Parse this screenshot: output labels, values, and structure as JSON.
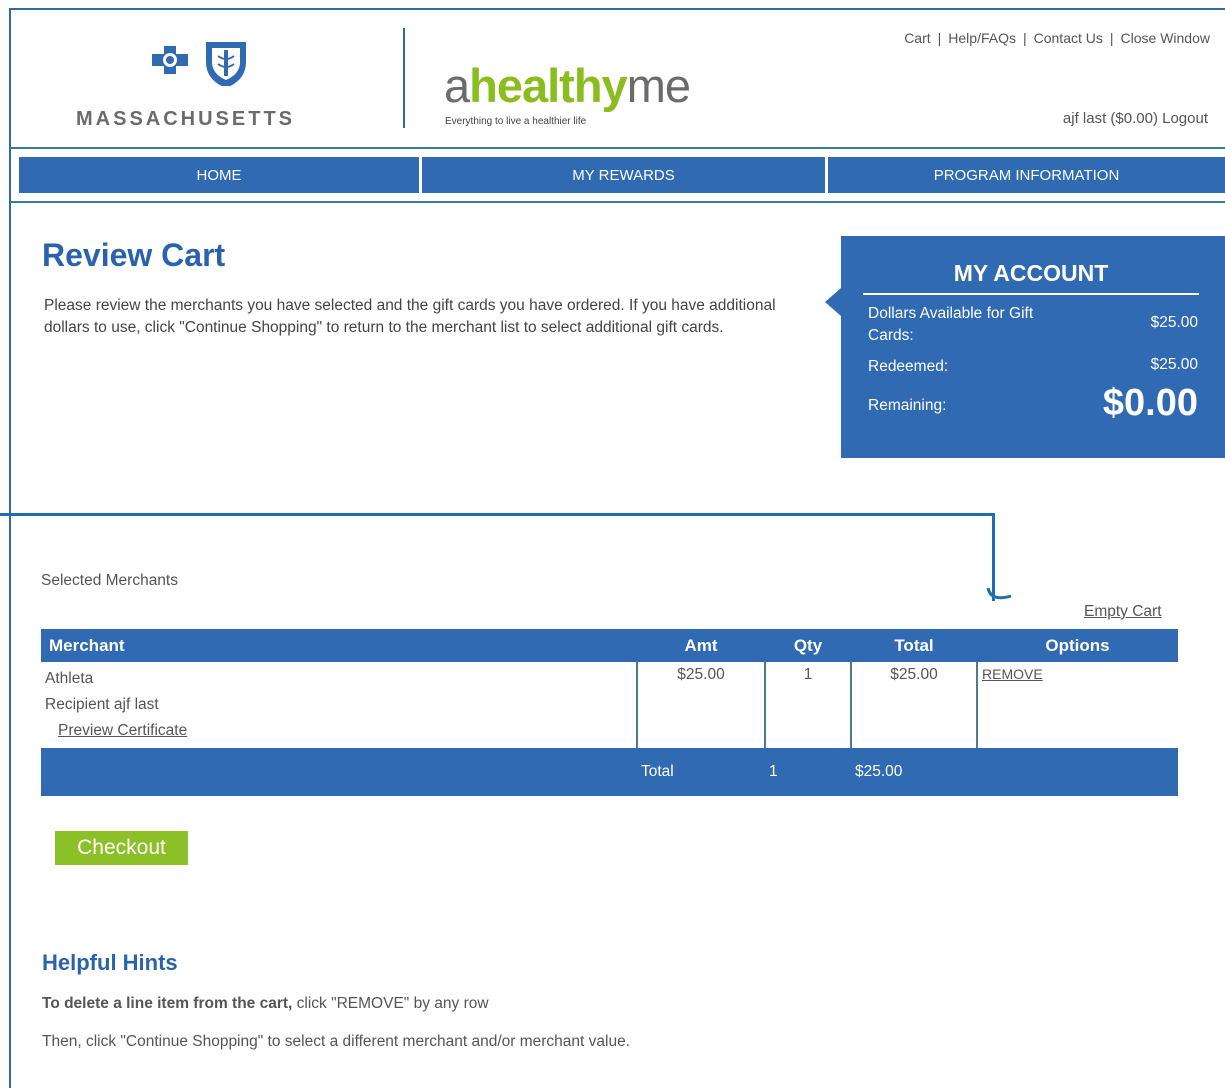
{
  "header": {
    "brand_region": "MASSACHUSETTS",
    "logo_a": "a",
    "logo_healthy": "healthy",
    "logo_me": "me",
    "tagline": "Everything to live a healthier life",
    "links": [
      "Cart",
      "Help/FAQs",
      "Contact Us",
      "Close Window"
    ],
    "user_text": "ajf last ($0.00)",
    "logout": "Logout"
  },
  "nav": {
    "items": [
      "HOME",
      "MY REWARDS",
      "PROGRAM INFORMATION"
    ]
  },
  "page": {
    "title": "Review Cart",
    "intro": "Please review the merchants you have selected and the gift cards you have ordered. If you have additional dollars to use, click \"Continue Shopping\" to return to the merchant list to select additional gift cards."
  },
  "account": {
    "title": "MY ACCOUNT",
    "available_label": "Dollars Available for Gift Cards:",
    "available_value": "$25.00",
    "redeemed_label": "Redeemed:",
    "redeemed_value": "$25.00",
    "remaining_label": "Remaining:",
    "remaining_value": "$0.00"
  },
  "cart": {
    "section_label": "Selected Merchants",
    "empty_cart": "Empty Cart",
    "columns": [
      "Merchant",
      "Amt",
      "Qty",
      "Total",
      "Options"
    ],
    "rows": [
      {
        "merchant": "Athleta",
        "recipient": "Recipient ajf last",
        "preview": "Preview Certificate",
        "amt": "$25.00",
        "qty": "1",
        "total": "$25.00",
        "option": "REMOVE"
      }
    ],
    "totals": {
      "label": "Total",
      "qty": "1",
      "amount": "$25.00"
    },
    "checkout": "Checkout"
  },
  "hints": {
    "title": "Helpful Hints",
    "hint1_bold": "To delete a line item from the cart,",
    "hint1_rest": " click \"REMOVE\" by any row",
    "hint2": "Then, click \"Continue Shopping\" to select a different merchant and/or merchant value."
  },
  "colors": {
    "brand_blue": "#2f6ab3",
    "brand_green": "#8bc126",
    "connector_blue": "#1f6fb0"
  }
}
